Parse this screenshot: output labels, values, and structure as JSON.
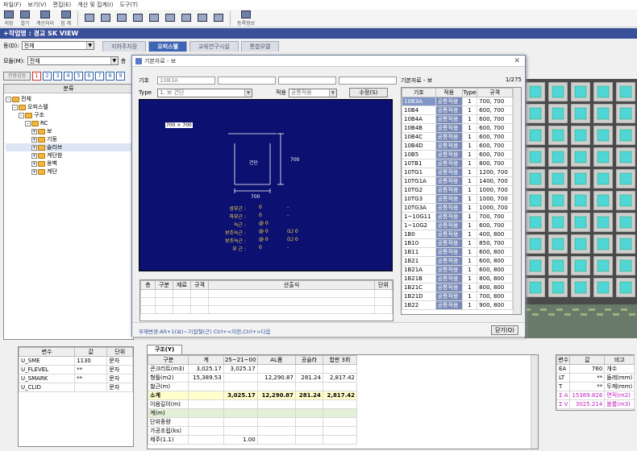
{
  "menu": [
    "파일(F)",
    "보기(V)",
    "편집(E)",
    "계산 및 집계(I)",
    "도구(T)"
  ],
  "toolbar": {
    "labels": [
      "저장",
      "열기",
      "계산처리",
      "집 계",
      "",
      "",
      "",
      "",
      "",
      "",
      "",
      "",
      "",
      "등록정보"
    ]
  },
  "app_title": "+작업명 : 경교 SK VIEW",
  "dong_label": "동(D):",
  "dong_value": "전체",
  "module_label": "모듈(M):",
  "module_value": "전체",
  "floor_label": "층",
  "main_tabs": [
    "지하주차장",
    "오피스텔",
    "교육연구시설",
    "통합모델"
  ],
  "tree_toolbar": {
    "label": "전층검정",
    "nums": [
      "1",
      "2",
      "3",
      "4",
      "5",
      "6",
      "7",
      "8",
      "9"
    ]
  },
  "tree_header": "분류",
  "tree": [
    {
      "label": "전체",
      "level": 0,
      "pm": "-"
    },
    {
      "label": "오피스텔",
      "level": 1,
      "pm": "-"
    },
    {
      "label": "구조",
      "level": 2,
      "pm": "-"
    },
    {
      "label": "RC",
      "level": 3,
      "pm": "-"
    },
    {
      "label": "보",
      "level": 4,
      "pm": "+"
    },
    {
      "label": "기둥",
      "level": 4,
      "pm": "+"
    },
    {
      "label": "슬라브",
      "level": 4,
      "pm": "+"
    },
    {
      "label": "계단참",
      "level": 4,
      "pm": "+"
    },
    {
      "label": "옹벽",
      "level": 4,
      "pm": "+"
    },
    {
      "label": "계단",
      "level": 4,
      "pm": "+"
    }
  ],
  "var_table": {
    "headers": [
      "변수",
      "값",
      "단위"
    ],
    "rows": [
      [
        "U_SME",
        "1130",
        "문자"
      ],
      [
        "U_FLEVEL",
        "**",
        "문자"
      ],
      [
        "U_SMARK",
        "**",
        "문자"
      ],
      [
        "U_CLID",
        "",
        "문자"
      ]
    ]
  },
  "dialog": {
    "title": "기본자료 - 보",
    "code_label": "기호",
    "code_value": "10B3A",
    "type_label": "Type",
    "type_value": "1. 보 건단",
    "apply_label": "적용",
    "apply_value": "공통적용",
    "modify_btn": "수정(S)",
    "canvas": {
      "dim_top": "700 × 700",
      "center": "건단",
      "side": "700",
      "bottom": "700",
      "rows": [
        [
          "상부근 :",
          "0",
          "-"
        ],
        [
          "하부근 :",
          "0",
          "-"
        ],
        [
          "늑근 :",
          "@ 0",
          ""
        ],
        [
          "보조늑근 :",
          "@ 0",
          "(L) 0"
        ],
        [
          "보조늑근 :",
          "@ 0",
          "(L) 0"
        ],
        [
          "부 근 :",
          "0",
          "-"
        ]
      ]
    },
    "calc_headers": [
      "층",
      "구분",
      "재료",
      "규격",
      "산출식",
      "단위"
    ],
    "hint": "부재변경:Alt+1(보)~7(잡철(근) Ctrl+<이전,Ctrl+>다음",
    "close_btn": "닫기(Q)",
    "list_title": "기본자료 - 보",
    "list_count": "1/275",
    "list_headers": [
      "기호",
      "적용",
      "Type",
      "규격"
    ],
    "list_rows": [
      [
        "10B3A",
        "공통적용",
        "1",
        "700, 700"
      ],
      [
        "10B4",
        "공통적용",
        "1",
        "600, 700"
      ],
      [
        "10B4A",
        "공통적용",
        "1",
        "600, 700"
      ],
      [
        "10B4B",
        "공통적용",
        "1",
        "600, 700"
      ],
      [
        "10B4C",
        "공통적용",
        "1",
        "600, 700"
      ],
      [
        "10B4D",
        "공통적용",
        "1",
        "600, 700"
      ],
      [
        "10B5",
        "공통적용",
        "1",
        "600, 700"
      ],
      [
        "10TB1",
        "공통적용",
        "1",
        "800, 700"
      ],
      [
        "10TG1",
        "공통적용",
        "1",
        "1200, 700"
      ],
      [
        "10TG1A",
        "공통적용",
        "1",
        "1400, 700"
      ],
      [
        "10TG2",
        "공통적용",
        "1",
        "1000, 700"
      ],
      [
        "10TG3",
        "공통적용",
        "1",
        "1000, 700"
      ],
      [
        "10TG3A",
        "공통적용",
        "1",
        "1000, 700"
      ],
      [
        "1~10G11",
        "공통적용",
        "1",
        "700, 700"
      ],
      [
        "1~10G2",
        "공통적용",
        "1",
        "600, 700"
      ],
      [
        "1B0",
        "공통적용",
        "1",
        "400, 800"
      ],
      [
        "1B10",
        "공통적용",
        "1",
        "850, 700"
      ],
      [
        "1B11",
        "공통적용",
        "1",
        "600, 800"
      ],
      [
        "1B21",
        "공통적용",
        "1",
        "600, 800"
      ],
      [
        "1B21A",
        "공통적용",
        "1",
        "600, 800"
      ],
      [
        "1B21B",
        "공통적용",
        "1",
        "800, 800"
      ],
      [
        "1B21C",
        "공통적용",
        "1",
        "800, 800"
      ],
      [
        "1B21D",
        "공통적용",
        "1",
        "700, 800"
      ],
      [
        "1B22",
        "공통적용",
        "1",
        "900, 800"
      ]
    ]
  },
  "bottom_tab": "구조(Y)",
  "sum_table": {
    "headers": [
      "구분",
      "계",
      "25~21~00",
      "AL폼",
      "공슬라",
      "합판 3회"
    ],
    "rows": [
      [
        "콘크리트(m3)",
        "3,025.17",
        "3,025.17",
        "",
        "",
        ""
      ],
      [
        "형틀(m2)",
        "15,389.53",
        "",
        "12,290.87",
        "281.24",
        "2,817.42"
      ],
      [
        "철근(m)",
        "",
        "",
        "",
        "",
        ""
      ],
      [
        "소계",
        "",
        "3,025.17",
        "12,290.87",
        "281.24",
        "2,817.42"
      ],
      [
        "이음길이(m)",
        "",
        "",
        "",
        "",
        ""
      ],
      [
        "계(m)",
        "",
        "",
        "",
        "",
        ""
      ],
      [
        "단위중량",
        "",
        "",
        "",
        "",
        ""
      ],
      [
        "가공조립(ks)",
        "",
        "",
        "",
        "",
        ""
      ],
      [
        "제주(1.1)",
        "",
        "1.00",
        "",
        "",
        ""
      ]
    ]
  },
  "right_table": {
    "headers": [
      "변수",
      "값",
      "비고"
    ],
    "rows": [
      [
        "EA",
        "760",
        "개수"
      ],
      [
        "LT",
        "**",
        "둘레(mm)"
      ],
      [
        "T",
        "**",
        "두께(mm)"
      ],
      [
        "Σ A",
        "15389.826",
        "면적(m2)"
      ],
      [
        "Σ V",
        "3025.214",
        "볼륨(m3)"
      ]
    ]
  },
  "colors": {
    "title_bg": "#3a4f9a",
    "canvas_bg": "#0c1070",
    "building_cyan": "#4fd6d6",
    "highlight": "#ffffcc"
  }
}
